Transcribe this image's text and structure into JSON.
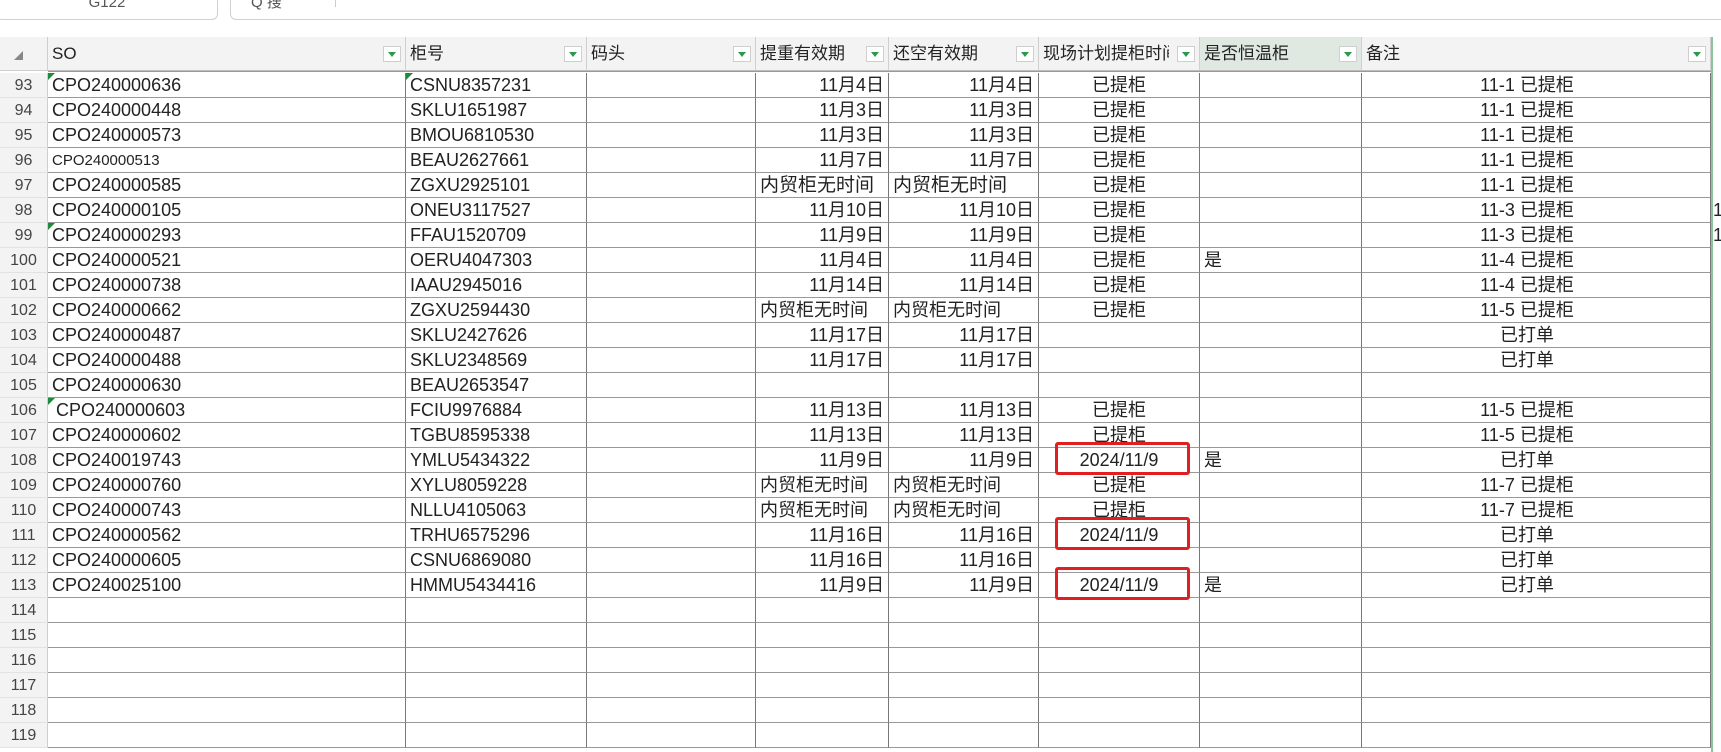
{
  "toolbar": {
    "name_box": "G122",
    "search_label": "Q 搜"
  },
  "columns": [
    {
      "key": "so",
      "label": "SO"
    },
    {
      "key": "cabinet",
      "label": "柜号"
    },
    {
      "key": "dock",
      "label": "码头"
    },
    {
      "key": "pickup_valid",
      "label": "提重有效期"
    },
    {
      "key": "return_valid",
      "label": "还空有效期"
    },
    {
      "key": "plan_time",
      "label": "现场计划提柜时间"
    },
    {
      "key": "temp",
      "label": "是否恒温柜"
    },
    {
      "key": "remark",
      "label": "备注"
    }
  ],
  "rows": [
    {
      "num": "93",
      "so": "CPO240000636",
      "cabinet": "CSNU8357231",
      "dock": "",
      "pickup_valid": "11月4日",
      "return_valid": "11月4日",
      "plan_time": "已提柜",
      "temp": "",
      "remark": "11-1 已提柜"
    },
    {
      "num": "94",
      "so": "CPO240000448",
      "cabinet": "SKLU1651987",
      "dock": "",
      "pickup_valid": "11月3日",
      "return_valid": "11月3日",
      "plan_time": "已提柜",
      "temp": "",
      "remark": "11-1 已提柜"
    },
    {
      "num": "95",
      "so": "CPO240000573",
      "cabinet": "BMOU6810530",
      "dock": "",
      "pickup_valid": "11月3日",
      "return_valid": "11月3日",
      "plan_time": "已提柜",
      "temp": "",
      "remark": "11-1 已提柜"
    },
    {
      "num": "96",
      "so": "CPO240000513",
      "cabinet": "BEAU2627661",
      "dock": "",
      "pickup_valid": "11月7日",
      "return_valid": "11月7日",
      "plan_time": "已提柜",
      "temp": "",
      "remark": "11-1 已提柜"
    },
    {
      "num": "97",
      "so": "CPO240000585",
      "cabinet": "ZGXU2925101",
      "dock": "",
      "pickup_valid": "内贸柜无时间",
      "return_valid": "内贸柜无时间",
      "plan_time": "已提柜",
      "temp": "",
      "remark": "11-1 已提柜"
    },
    {
      "num": "98",
      "so": "CPO240000105",
      "cabinet": "ONEU3117527",
      "dock": "",
      "pickup_valid": "11月10日",
      "return_valid": "11月10日",
      "plan_time": "已提柜",
      "temp": "",
      "remark": "11-3 已提柜"
    },
    {
      "num": "99",
      "so": "CPO240000293",
      "cabinet": "FFAU1520709",
      "dock": "",
      "pickup_valid": "11月9日",
      "return_valid": "11月9日",
      "plan_time": "已提柜",
      "temp": "",
      "remark": "11-3 已提柜"
    },
    {
      "num": "100",
      "so": "CPO240000521",
      "cabinet": "OERU4047303",
      "dock": "",
      "pickup_valid": "11月4日",
      "return_valid": "11月4日",
      "plan_time": "已提柜",
      "temp": "是",
      "remark": "11-4 已提柜"
    },
    {
      "num": "101",
      "so": "CPO240000738",
      "cabinet": "IAAU2945016",
      "dock": "",
      "pickup_valid": "11月14日",
      "return_valid": "11月14日",
      "plan_time": "已提柜",
      "temp": "",
      "remark": "11-4 已提柜"
    },
    {
      "num": "102",
      "so": "CPO240000662",
      "cabinet": "ZGXU2594430",
      "dock": "",
      "pickup_valid": "内贸柜无时间",
      "return_valid": "内贸柜无时间",
      "plan_time": "已提柜",
      "temp": "",
      "remark": "11-5 已提柜"
    },
    {
      "num": "103",
      "so": "CPO240000487",
      "cabinet": "SKLU2427626",
      "dock": "",
      "pickup_valid": "11月17日",
      "return_valid": "11月17日",
      "plan_time": "",
      "temp": "",
      "remark": "已打单"
    },
    {
      "num": "104",
      "so": "CPO240000488",
      "cabinet": "SKLU2348569",
      "dock": "",
      "pickup_valid": "11月17日",
      "return_valid": "11月17日",
      "plan_time": "",
      "temp": "",
      "remark": "已打单"
    },
    {
      "num": "105",
      "so": "CPO240000630",
      "cabinet": "BEAU2653547",
      "dock": "",
      "pickup_valid": "",
      "return_valid": "",
      "plan_time": "",
      "temp": "",
      "remark": ""
    },
    {
      "num": "106",
      "so": "CPO240000603",
      "cabinet": "FCIU9976884",
      "dock": "",
      "pickup_valid": "11月13日",
      "return_valid": "11月13日",
      "plan_time": "已提柜",
      "temp": "",
      "remark": "11-5 已提柜"
    },
    {
      "num": "107",
      "so": "CPO240000602",
      "cabinet": "TGBU8595338",
      "dock": "",
      "pickup_valid": "11月13日",
      "return_valid": "11月13日",
      "plan_time": "已提柜",
      "temp": "",
      "remark": "11-5 已提柜"
    },
    {
      "num": "108",
      "so": "CPO240019743",
      "cabinet": "YMLU5434322",
      "dock": "",
      "pickup_valid": "11月9日",
      "return_valid": "11月9日",
      "plan_time": "2024/11/9",
      "temp": "是",
      "remark": "已打单"
    },
    {
      "num": "109",
      "so": "CPO240000760",
      "cabinet": "XYLU8059228",
      "dock": "",
      "pickup_valid": "内贸柜无时间",
      "return_valid": "内贸柜无时间",
      "plan_time": "已提柜",
      "temp": "",
      "remark": "11-7 已提柜"
    },
    {
      "num": "110",
      "so": "CPO240000743",
      "cabinet": "NLLU4105063",
      "dock": "",
      "pickup_valid": "内贸柜无时间",
      "return_valid": "内贸柜无时间",
      "plan_time": "已提柜",
      "temp": "",
      "remark": "11-7 已提柜"
    },
    {
      "num": "111",
      "so": "CPO240000562",
      "cabinet": "TRHU6575296",
      "dock": "",
      "pickup_valid": "11月16日",
      "return_valid": "11月16日",
      "plan_time": "2024/11/9",
      "temp": "",
      "remark": "已打单"
    },
    {
      "num": "112",
      "so": "CPO240000605",
      "cabinet": "CSNU6869080",
      "dock": "",
      "pickup_valid": "11月16日",
      "return_valid": "11月16日",
      "plan_time": "",
      "temp": "",
      "remark": "已打单"
    },
    {
      "num": "113",
      "so": "CPO240025100",
      "cabinet": "HMMU5434416",
      "dock": "",
      "pickup_valid": "11月9日",
      "return_valid": "11月9日",
      "plan_time": "2024/11/9",
      "temp": "是",
      "remark": "已打单"
    },
    {
      "num": "114",
      "so": "",
      "cabinet": "",
      "dock": "",
      "pickup_valid": "",
      "return_valid": "",
      "plan_time": "",
      "temp": "",
      "remark": ""
    },
    {
      "num": "115",
      "so": "",
      "cabinet": "",
      "dock": "",
      "pickup_valid": "",
      "return_valid": "",
      "plan_time": "",
      "temp": "",
      "remark": ""
    },
    {
      "num": "116",
      "so": "",
      "cabinet": "",
      "dock": "",
      "pickup_valid": "",
      "return_valid": "",
      "plan_time": "",
      "temp": "",
      "remark": ""
    },
    {
      "num": "117",
      "so": "",
      "cabinet": "",
      "dock": "",
      "pickup_valid": "",
      "return_valid": "",
      "plan_time": "",
      "temp": "",
      "remark": ""
    },
    {
      "num": "118",
      "so": "",
      "cabinet": "",
      "dock": "",
      "pickup_valid": "",
      "return_valid": "",
      "plan_time": "",
      "temp": "",
      "remark": ""
    },
    {
      "num": "119",
      "so": "",
      "cabinet": "",
      "dock": "",
      "pickup_valid": "",
      "return_valid": "",
      "plan_time": "",
      "temp": "",
      "remark": ""
    }
  ],
  "overflow_marks": [
    "1",
    "1"
  ],
  "highlight_color": "#e02020",
  "accent_color": "#1e8a3a"
}
